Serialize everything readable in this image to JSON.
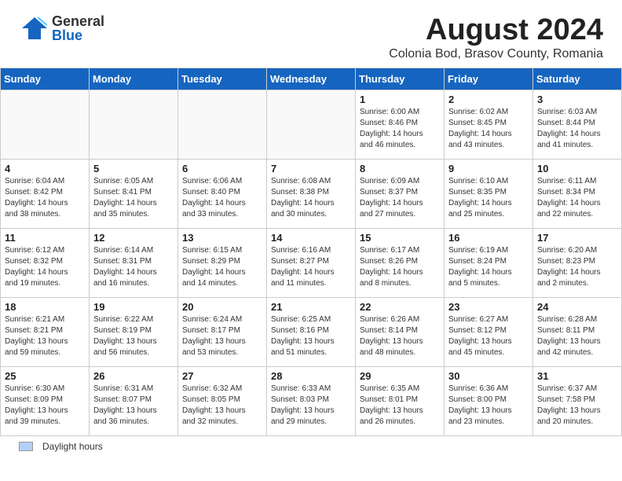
{
  "logo": {
    "general": "General",
    "blue": "Blue"
  },
  "title": "August 2024",
  "subtitle": "Colonia Bod, Brasov County, Romania",
  "weekdays": [
    "Sunday",
    "Monday",
    "Tuesday",
    "Wednesday",
    "Thursday",
    "Friday",
    "Saturday"
  ],
  "days": [
    {
      "date": "",
      "info": ""
    },
    {
      "date": "",
      "info": ""
    },
    {
      "date": "",
      "info": ""
    },
    {
      "date": "",
      "info": ""
    },
    {
      "date": "1",
      "info": "Sunrise: 6:00 AM\nSunset: 8:46 PM\nDaylight: 14 hours\nand 46 minutes."
    },
    {
      "date": "2",
      "info": "Sunrise: 6:02 AM\nSunset: 8:45 PM\nDaylight: 14 hours\nand 43 minutes."
    },
    {
      "date": "3",
      "info": "Sunrise: 6:03 AM\nSunset: 8:44 PM\nDaylight: 14 hours\nand 41 minutes."
    },
    {
      "date": "4",
      "info": "Sunrise: 6:04 AM\nSunset: 8:42 PM\nDaylight: 14 hours\nand 38 minutes."
    },
    {
      "date": "5",
      "info": "Sunrise: 6:05 AM\nSunset: 8:41 PM\nDaylight: 14 hours\nand 35 minutes."
    },
    {
      "date": "6",
      "info": "Sunrise: 6:06 AM\nSunset: 8:40 PM\nDaylight: 14 hours\nand 33 minutes."
    },
    {
      "date": "7",
      "info": "Sunrise: 6:08 AM\nSunset: 8:38 PM\nDaylight: 14 hours\nand 30 minutes."
    },
    {
      "date": "8",
      "info": "Sunrise: 6:09 AM\nSunset: 8:37 PM\nDaylight: 14 hours\nand 27 minutes."
    },
    {
      "date": "9",
      "info": "Sunrise: 6:10 AM\nSunset: 8:35 PM\nDaylight: 14 hours\nand 25 minutes."
    },
    {
      "date": "10",
      "info": "Sunrise: 6:11 AM\nSunset: 8:34 PM\nDaylight: 14 hours\nand 22 minutes."
    },
    {
      "date": "11",
      "info": "Sunrise: 6:12 AM\nSunset: 8:32 PM\nDaylight: 14 hours\nand 19 minutes."
    },
    {
      "date": "12",
      "info": "Sunrise: 6:14 AM\nSunset: 8:31 PM\nDaylight: 14 hours\nand 16 minutes."
    },
    {
      "date": "13",
      "info": "Sunrise: 6:15 AM\nSunset: 8:29 PM\nDaylight: 14 hours\nand 14 minutes."
    },
    {
      "date": "14",
      "info": "Sunrise: 6:16 AM\nSunset: 8:27 PM\nDaylight: 14 hours\nand 11 minutes."
    },
    {
      "date": "15",
      "info": "Sunrise: 6:17 AM\nSunset: 8:26 PM\nDaylight: 14 hours\nand 8 minutes."
    },
    {
      "date": "16",
      "info": "Sunrise: 6:19 AM\nSunset: 8:24 PM\nDaylight: 14 hours\nand 5 minutes."
    },
    {
      "date": "17",
      "info": "Sunrise: 6:20 AM\nSunset: 8:23 PM\nDaylight: 14 hours\nand 2 minutes."
    },
    {
      "date": "18",
      "info": "Sunrise: 6:21 AM\nSunset: 8:21 PM\nDaylight: 13 hours\nand 59 minutes."
    },
    {
      "date": "19",
      "info": "Sunrise: 6:22 AM\nSunset: 8:19 PM\nDaylight: 13 hours\nand 56 minutes."
    },
    {
      "date": "20",
      "info": "Sunrise: 6:24 AM\nSunset: 8:17 PM\nDaylight: 13 hours\nand 53 minutes."
    },
    {
      "date": "21",
      "info": "Sunrise: 6:25 AM\nSunset: 8:16 PM\nDaylight: 13 hours\nand 51 minutes."
    },
    {
      "date": "22",
      "info": "Sunrise: 6:26 AM\nSunset: 8:14 PM\nDaylight: 13 hours\nand 48 minutes."
    },
    {
      "date": "23",
      "info": "Sunrise: 6:27 AM\nSunset: 8:12 PM\nDaylight: 13 hours\nand 45 minutes."
    },
    {
      "date": "24",
      "info": "Sunrise: 6:28 AM\nSunset: 8:11 PM\nDaylight: 13 hours\nand 42 minutes."
    },
    {
      "date": "25",
      "info": "Sunrise: 6:30 AM\nSunset: 8:09 PM\nDaylight: 13 hours\nand 39 minutes."
    },
    {
      "date": "26",
      "info": "Sunrise: 6:31 AM\nSunset: 8:07 PM\nDaylight: 13 hours\nand 36 minutes."
    },
    {
      "date": "27",
      "info": "Sunrise: 6:32 AM\nSunset: 8:05 PM\nDaylight: 13 hours\nand 32 minutes."
    },
    {
      "date": "28",
      "info": "Sunrise: 6:33 AM\nSunset: 8:03 PM\nDaylight: 13 hours\nand 29 minutes."
    },
    {
      "date": "29",
      "info": "Sunrise: 6:35 AM\nSunset: 8:01 PM\nDaylight: 13 hours\nand 26 minutes."
    },
    {
      "date": "30",
      "info": "Sunrise: 6:36 AM\nSunset: 8:00 PM\nDaylight: 13 hours\nand 23 minutes."
    },
    {
      "date": "31",
      "info": "Sunrise: 6:37 AM\nSunset: 7:58 PM\nDaylight: 13 hours\nand 20 minutes."
    }
  ],
  "footer": {
    "legend_label": "Daylight hours"
  }
}
